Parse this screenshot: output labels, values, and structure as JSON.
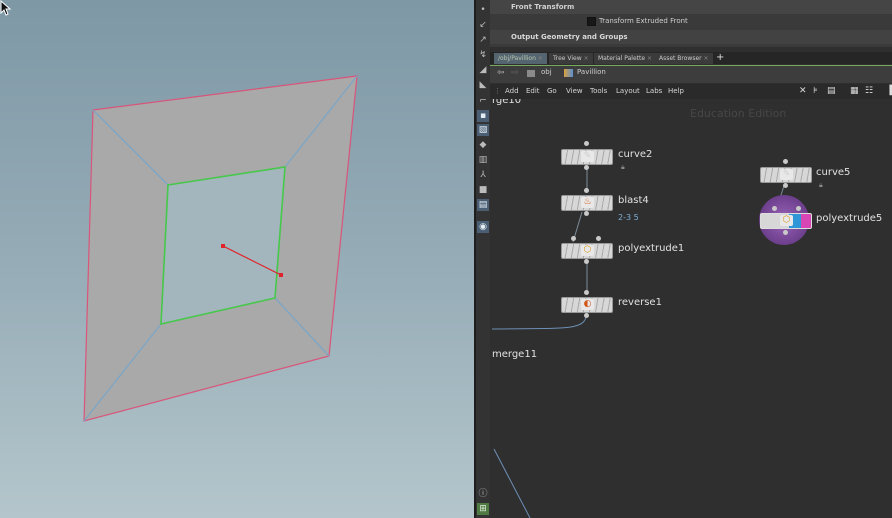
{
  "viewport": {
    "colors": {
      "outer_edge": "#d9557a",
      "inner_edge": "#46c84a",
      "diagonals": "#7ea6c4",
      "normal": "#e0222a"
    }
  },
  "params": {
    "row1": "Front Transform",
    "row2": "Transform Extruded Front",
    "row3": "Output Geometry and Groups"
  },
  "tabs": [
    "/obj/Pavillion",
    "Tree View",
    "Material Palette",
    "Asset Browser"
  ],
  "tab_add": "+",
  "pathbar": {
    "obj": "obj",
    "pavillion": "Pavillion"
  },
  "menu": [
    "Add",
    "Edit",
    "Go",
    "View",
    "Tools",
    "Layout",
    "Labs",
    "Help"
  ],
  "network": {
    "watermark": "Education Edition",
    "nodes": {
      "merge10": "rge10",
      "curve2": "curve2",
      "blast4": "blast4",
      "blast4_info": "2-3 5",
      "polyextrude1": "polyextrude1",
      "reverse1": "reverse1",
      "merge11": "merge11",
      "curve5": "curve5",
      "polyextrude5": "polyextrude5"
    },
    "icons": {
      "curve": "curve-icon",
      "blast": "blast-icon",
      "polyextrude": "polyextrude-icon",
      "reverse": "reverse-icon",
      "lock": "lock-icon"
    }
  }
}
